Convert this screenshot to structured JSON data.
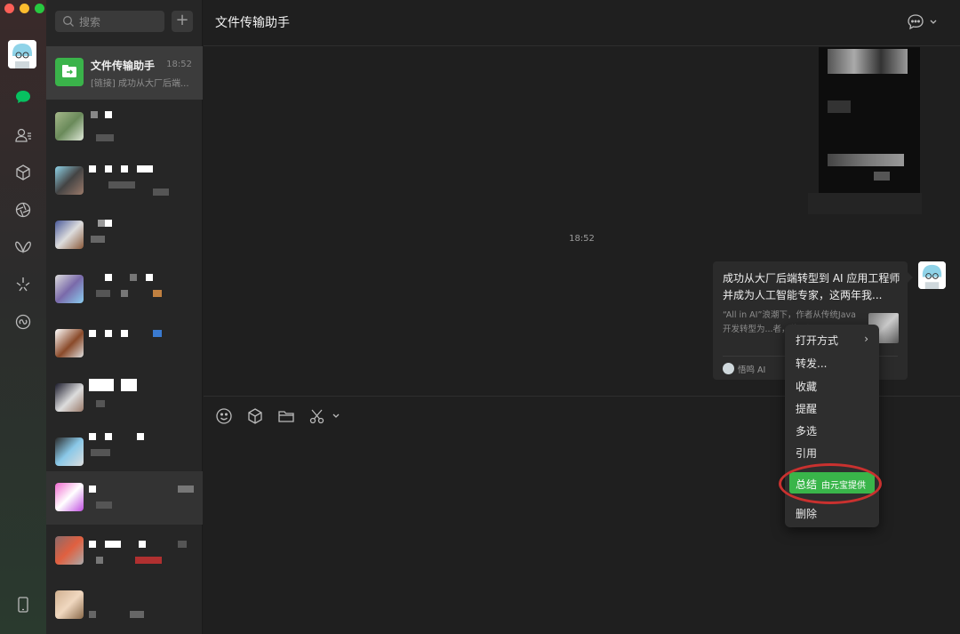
{
  "window": {
    "controls": {
      "close_color": "#fe5f57",
      "minimize_color": "#febc2e",
      "zoom_color": "#28c840"
    }
  },
  "navbar": {
    "items": [
      {
        "name": "chats",
        "icon": "chat-bubble-icon",
        "active": true,
        "color": "#07c160"
      },
      {
        "name": "contacts",
        "icon": "contacts-icon"
      },
      {
        "name": "favorites",
        "icon": "cube-icon"
      },
      {
        "name": "moments",
        "icon": "aperture-icon"
      },
      {
        "name": "channels",
        "icon": "butterfly-icon"
      },
      {
        "name": "search",
        "icon": "sparkle-icon"
      },
      {
        "name": "mini-programs",
        "icon": "link-icon"
      }
    ],
    "bottom": {
      "icon": "phone-icon"
    }
  },
  "search": {
    "placeholder": "搜索",
    "add_label": "+"
  },
  "chat_list": {
    "active": {
      "name": "文件传输助手",
      "time": "18:52",
      "preview": "[链接] 成功从大厂后端..."
    }
  },
  "chat": {
    "title": "文件传输助手",
    "time_label": "18:52",
    "link_card": {
      "title": "成功从大厂后端转型到 AI 应用工程师并成为人工智能专家，这两年我...",
      "description": "“All in AI”浪潮下，作者从传统Java开发转型为...者，他强调要用",
      "source": "悟鸣 AI"
    }
  },
  "context_menu": {
    "items": [
      "打开方式",
      "转发...",
      "收藏",
      "提醒",
      "多选",
      "引用"
    ],
    "summary_label": "总结",
    "summary_provider": "由元宝提供",
    "delete_label": "删除",
    "submenu_arrow": "›"
  },
  "colors": {
    "accent": "#07c160",
    "summary_green": "#39b54a",
    "ring_red": "#c9312f"
  }
}
